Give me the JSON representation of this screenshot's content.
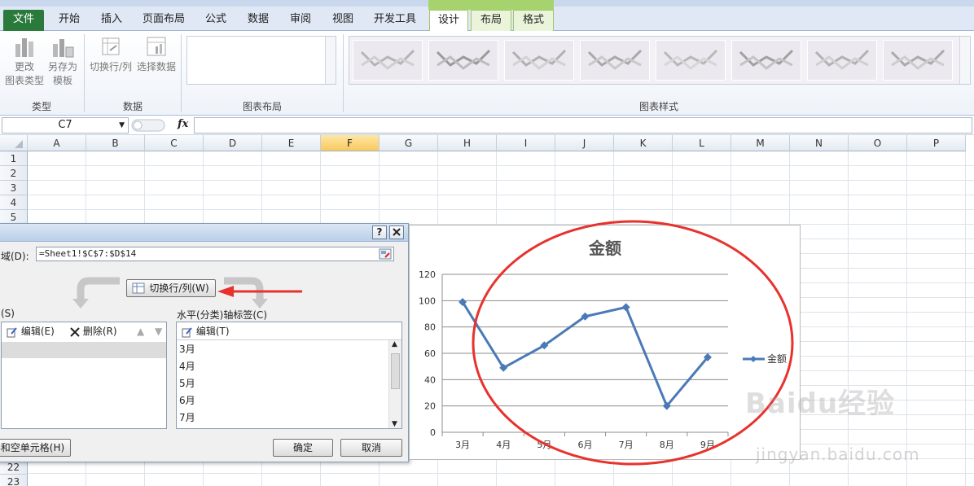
{
  "ribbon": {
    "tabs": [
      "文件",
      "开始",
      "插入",
      "页面布局",
      "公式",
      "数据",
      "审阅",
      "视图",
      "开发工具",
      "设计",
      "布局",
      "格式"
    ],
    "active_tab": "设计",
    "groups": {
      "type": {
        "label": "类型",
        "change_type": [
          "更改",
          "图表类型"
        ],
        "save_template": [
          "另存为",
          "模板"
        ]
      },
      "data": {
        "label": "数据",
        "switch_row_col": "切换行/列",
        "select_data": "选择数据"
      },
      "layout": {
        "label": "图表布局"
      },
      "styles": {
        "label": "图表样式"
      }
    }
  },
  "formula_bar": {
    "name_box": "C7",
    "fx": "fx"
  },
  "grid": {
    "columns": [
      "A",
      "B",
      "C",
      "D",
      "E",
      "F",
      "G",
      "H",
      "I",
      "J",
      "K",
      "L",
      "M",
      "N",
      "O",
      "P"
    ],
    "selected_column": "F",
    "rows_top": [
      "1",
      "2",
      "3",
      "4",
      "5"
    ],
    "rows_bottom": [
      "22",
      "23"
    ]
  },
  "dialog": {
    "range_label": "域(D):",
    "range_value": "=Sheet1!$C$7:$D$14",
    "switch_button": "切换行/列(W)",
    "series_label": "(S)",
    "edit_series": "编辑(E)",
    "delete_series": "删除(R)",
    "axis_label": "水平(分类)轴标签(C)",
    "edit_axis": "编辑(T)",
    "axis_items": [
      "3月",
      "4月",
      "5月",
      "6月",
      "7月"
    ],
    "hidden_cells_button": "格和空单元格(H)",
    "ok_button": "确定",
    "cancel_button": "取消"
  },
  "chart_data": {
    "type": "line",
    "title": "金额",
    "categories": [
      "3月",
      "4月",
      "5月",
      "6月",
      "7月",
      "8月",
      "9月"
    ],
    "series": [
      {
        "name": "金额",
        "values": [
          99,
          49,
          66,
          88,
          95,
          20,
          57
        ],
        "color": "#4a7ab5"
      }
    ],
    "ylim": [
      0,
      120
    ],
    "yticks": [
      "0",
      "20",
      "40",
      "60",
      "80",
      "100",
      "120"
    ],
    "grid": true,
    "legend": "right"
  },
  "colors": {
    "annotation": "#e8322d",
    "file_tab": "#2a7a3b",
    "context_tab": "#a7d36e"
  },
  "watermark": {
    "brand": "Baidu经验",
    "url": "jingyan.baidu.com"
  }
}
